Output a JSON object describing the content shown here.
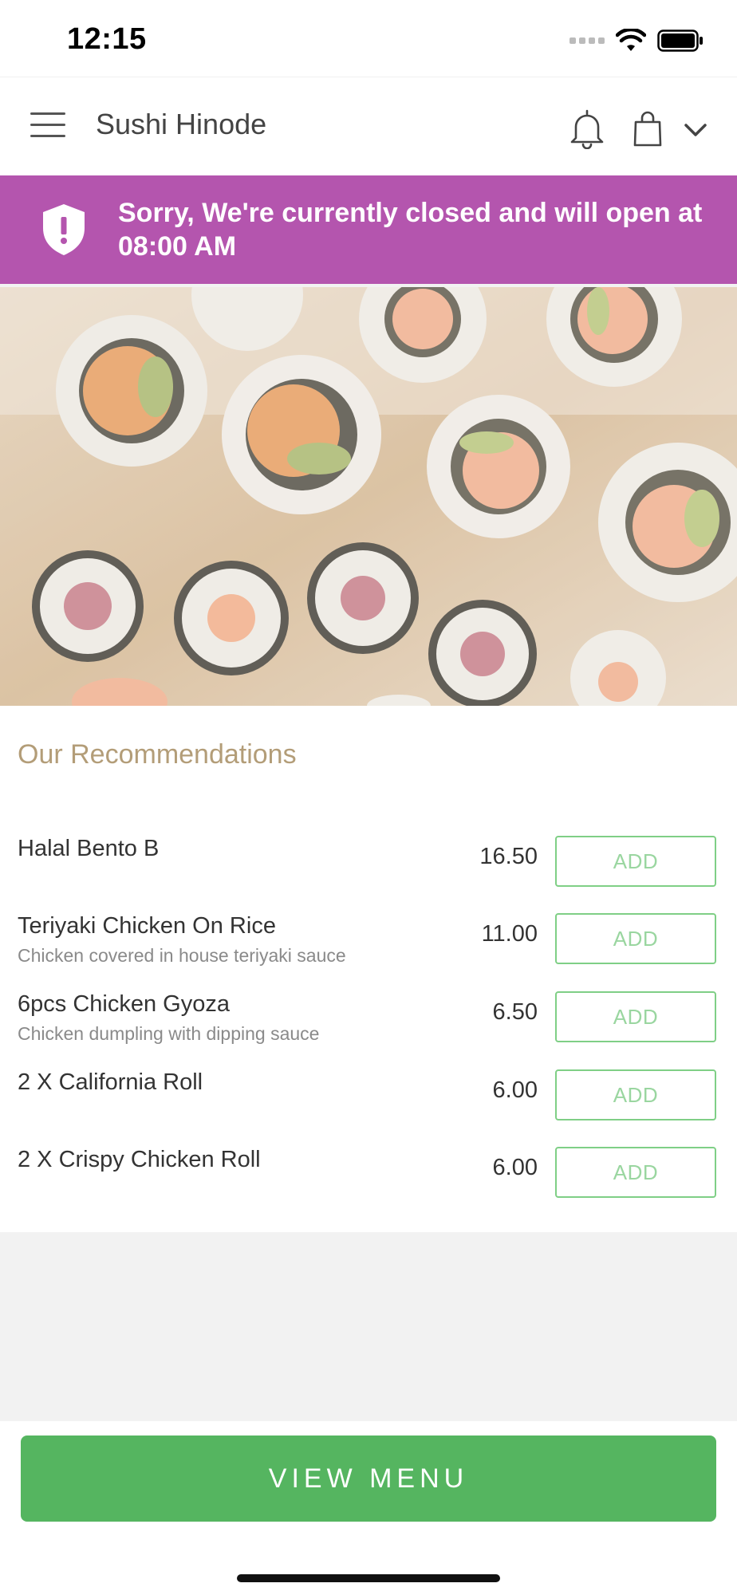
{
  "status": {
    "time": "12:15"
  },
  "header": {
    "title": "Sushi Hinode"
  },
  "banner": {
    "message": "Sorry, We're currently closed and will open at 08:00 AM"
  },
  "recommendations": {
    "title": "Our Recommendations",
    "items": [
      {
        "name": "Halal Bento B",
        "description": "",
        "price": "16.50",
        "button": "ADD"
      },
      {
        "name": "Teriyaki Chicken On Rice",
        "description": "Chicken covered in house teriyaki sauce",
        "price": "11.00",
        "button": "ADD"
      },
      {
        "name": "6pcs Chicken Gyoza",
        "description": "Chicken dumpling with dipping sauce",
        "price": "6.50",
        "button": "ADD"
      },
      {
        "name": "2 X California Roll",
        "description": "",
        "price": "6.00",
        "button": "ADD"
      },
      {
        "name": "2 X Crispy Chicken Roll",
        "description": "",
        "price": "6.00",
        "button": "ADD"
      }
    ]
  },
  "footer": {
    "view_menu_label": "VIEW MENU"
  },
  "colors": {
    "banner": "#b455ae",
    "accent_green": "#55b560",
    "recs_title": "#b39d78"
  }
}
